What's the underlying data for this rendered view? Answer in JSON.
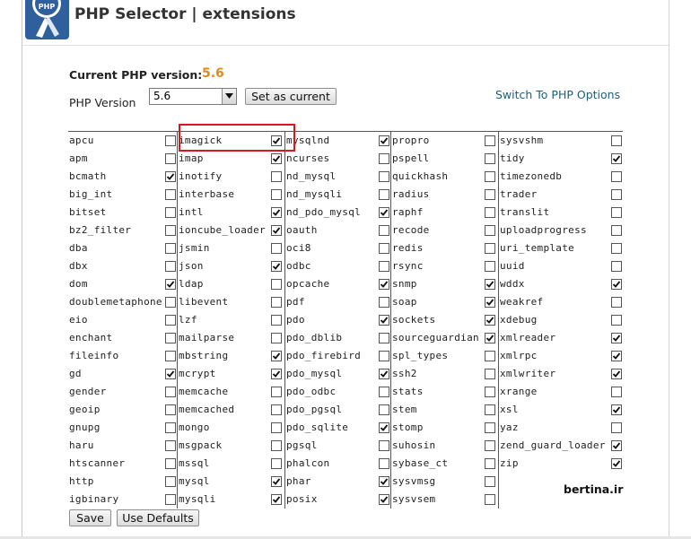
{
  "header": {
    "title": "PHP Selector | extensions",
    "logo_text": "PHP"
  },
  "version": {
    "current_label": "Current PHP version:",
    "current_value": "5.6",
    "select_label": "PHP Version",
    "selected_value": "5.6",
    "set_current_label": "Set as current",
    "switch_link": "Switch To PHP Options"
  },
  "extensions": {
    "columns": [
      [
        {
          "name": "apcu",
          "checked": false
        },
        {
          "name": "apm",
          "checked": false
        },
        {
          "name": "bcmath",
          "checked": true
        },
        {
          "name": "big_int",
          "checked": false
        },
        {
          "name": "bitset",
          "checked": false
        },
        {
          "name": "bz2_filter",
          "checked": false
        },
        {
          "name": "dba",
          "checked": false
        },
        {
          "name": "dbx",
          "checked": false
        },
        {
          "name": "dom",
          "checked": true
        },
        {
          "name": "doublemetaphone",
          "checked": false
        },
        {
          "name": "eio",
          "checked": false
        },
        {
          "name": "enchant",
          "checked": false
        },
        {
          "name": "fileinfo",
          "checked": false
        },
        {
          "name": "gd",
          "checked": true
        },
        {
          "name": "gender",
          "checked": false
        },
        {
          "name": "geoip",
          "checked": false
        },
        {
          "name": "gnupg",
          "checked": false
        },
        {
          "name": "haru",
          "checked": false
        },
        {
          "name": "htscanner",
          "checked": false
        },
        {
          "name": "http",
          "checked": false
        },
        {
          "name": "igbinary",
          "checked": false
        }
      ],
      [
        {
          "name": "imagick",
          "checked": true
        },
        {
          "name": "imap",
          "checked": true
        },
        {
          "name": "inotify",
          "checked": false
        },
        {
          "name": "interbase",
          "checked": false
        },
        {
          "name": "intl",
          "checked": true
        },
        {
          "name": "ioncube_loader",
          "checked": true
        },
        {
          "name": "jsmin",
          "checked": false
        },
        {
          "name": "json",
          "checked": true
        },
        {
          "name": "ldap",
          "checked": false
        },
        {
          "name": "libevent",
          "checked": false
        },
        {
          "name": "lzf",
          "checked": false
        },
        {
          "name": "mailparse",
          "checked": false
        },
        {
          "name": "mbstring",
          "checked": true
        },
        {
          "name": "mcrypt",
          "checked": true
        },
        {
          "name": "memcache",
          "checked": false
        },
        {
          "name": "memcached",
          "checked": false
        },
        {
          "name": "mongo",
          "checked": false
        },
        {
          "name": "msgpack",
          "checked": false
        },
        {
          "name": "mssql",
          "checked": false
        },
        {
          "name": "mysql",
          "checked": true
        },
        {
          "name": "mysqli",
          "checked": true
        }
      ],
      [
        {
          "name": "mysqlnd",
          "checked": true
        },
        {
          "name": "ncurses",
          "checked": false
        },
        {
          "name": "nd_mysql",
          "checked": false
        },
        {
          "name": "nd_mysqli",
          "checked": false
        },
        {
          "name": "nd_pdo_mysql",
          "checked": true
        },
        {
          "name": "oauth",
          "checked": false
        },
        {
          "name": "oci8",
          "checked": false
        },
        {
          "name": "odbc",
          "checked": false
        },
        {
          "name": "opcache",
          "checked": true
        },
        {
          "name": "pdf",
          "checked": false
        },
        {
          "name": "pdo",
          "checked": true
        },
        {
          "name": "pdo_dblib",
          "checked": false
        },
        {
          "name": "pdo_firebird",
          "checked": false
        },
        {
          "name": "pdo_mysql",
          "checked": true
        },
        {
          "name": "pdo_odbc",
          "checked": false
        },
        {
          "name": "pdo_pgsql",
          "checked": false
        },
        {
          "name": "pdo_sqlite",
          "checked": true
        },
        {
          "name": "pgsql",
          "checked": false
        },
        {
          "name": "phalcon",
          "checked": false
        },
        {
          "name": "phar",
          "checked": true
        },
        {
          "name": "posix",
          "checked": true
        }
      ],
      [
        {
          "name": "propro",
          "checked": false
        },
        {
          "name": "pspell",
          "checked": false
        },
        {
          "name": "quickhash",
          "checked": false
        },
        {
          "name": "radius",
          "checked": false
        },
        {
          "name": "raphf",
          "checked": false
        },
        {
          "name": "recode",
          "checked": false
        },
        {
          "name": "redis",
          "checked": false
        },
        {
          "name": "rsync",
          "checked": false
        },
        {
          "name": "snmp",
          "checked": true
        },
        {
          "name": "soap",
          "checked": true
        },
        {
          "name": "sockets",
          "checked": true
        },
        {
          "name": "sourceguardian",
          "checked": true
        },
        {
          "name": "spl_types",
          "checked": false
        },
        {
          "name": "ssh2",
          "checked": false
        },
        {
          "name": "stats",
          "checked": false
        },
        {
          "name": "stem",
          "checked": false
        },
        {
          "name": "stomp",
          "checked": false
        },
        {
          "name": "suhosin",
          "checked": false
        },
        {
          "name": "sybase_ct",
          "checked": false
        },
        {
          "name": "sysvmsg",
          "checked": false
        },
        {
          "name": "sysvsem",
          "checked": false
        }
      ],
      [
        {
          "name": "sysvshm",
          "checked": false
        },
        {
          "name": "tidy",
          "checked": true
        },
        {
          "name": "timezonedb",
          "checked": false
        },
        {
          "name": "trader",
          "checked": false
        },
        {
          "name": "translit",
          "checked": false
        },
        {
          "name": "uploadprogress",
          "checked": false
        },
        {
          "name": "uri_template",
          "checked": false
        },
        {
          "name": "uuid",
          "checked": false
        },
        {
          "name": "wddx",
          "checked": true
        },
        {
          "name": "weakref",
          "checked": false
        },
        {
          "name": "xdebug",
          "checked": false
        },
        {
          "name": "xmlreader",
          "checked": true
        },
        {
          "name": "xmlrpc",
          "checked": true
        },
        {
          "name": "xmlwriter",
          "checked": true
        },
        {
          "name": "xrange",
          "checked": false
        },
        {
          "name": "xsl",
          "checked": true
        },
        {
          "name": "yaz",
          "checked": false
        },
        {
          "name": "zend_guard_loader",
          "checked": true
        },
        {
          "name": "zip",
          "checked": true
        }
      ]
    ]
  },
  "watermark": "bertina.ir",
  "actions": {
    "save_label": "Save",
    "defaults_label": "Use Defaults"
  },
  "colors": {
    "current_version": "#e08a1e",
    "link": "#19617a",
    "highlight": "#d7191f"
  }
}
